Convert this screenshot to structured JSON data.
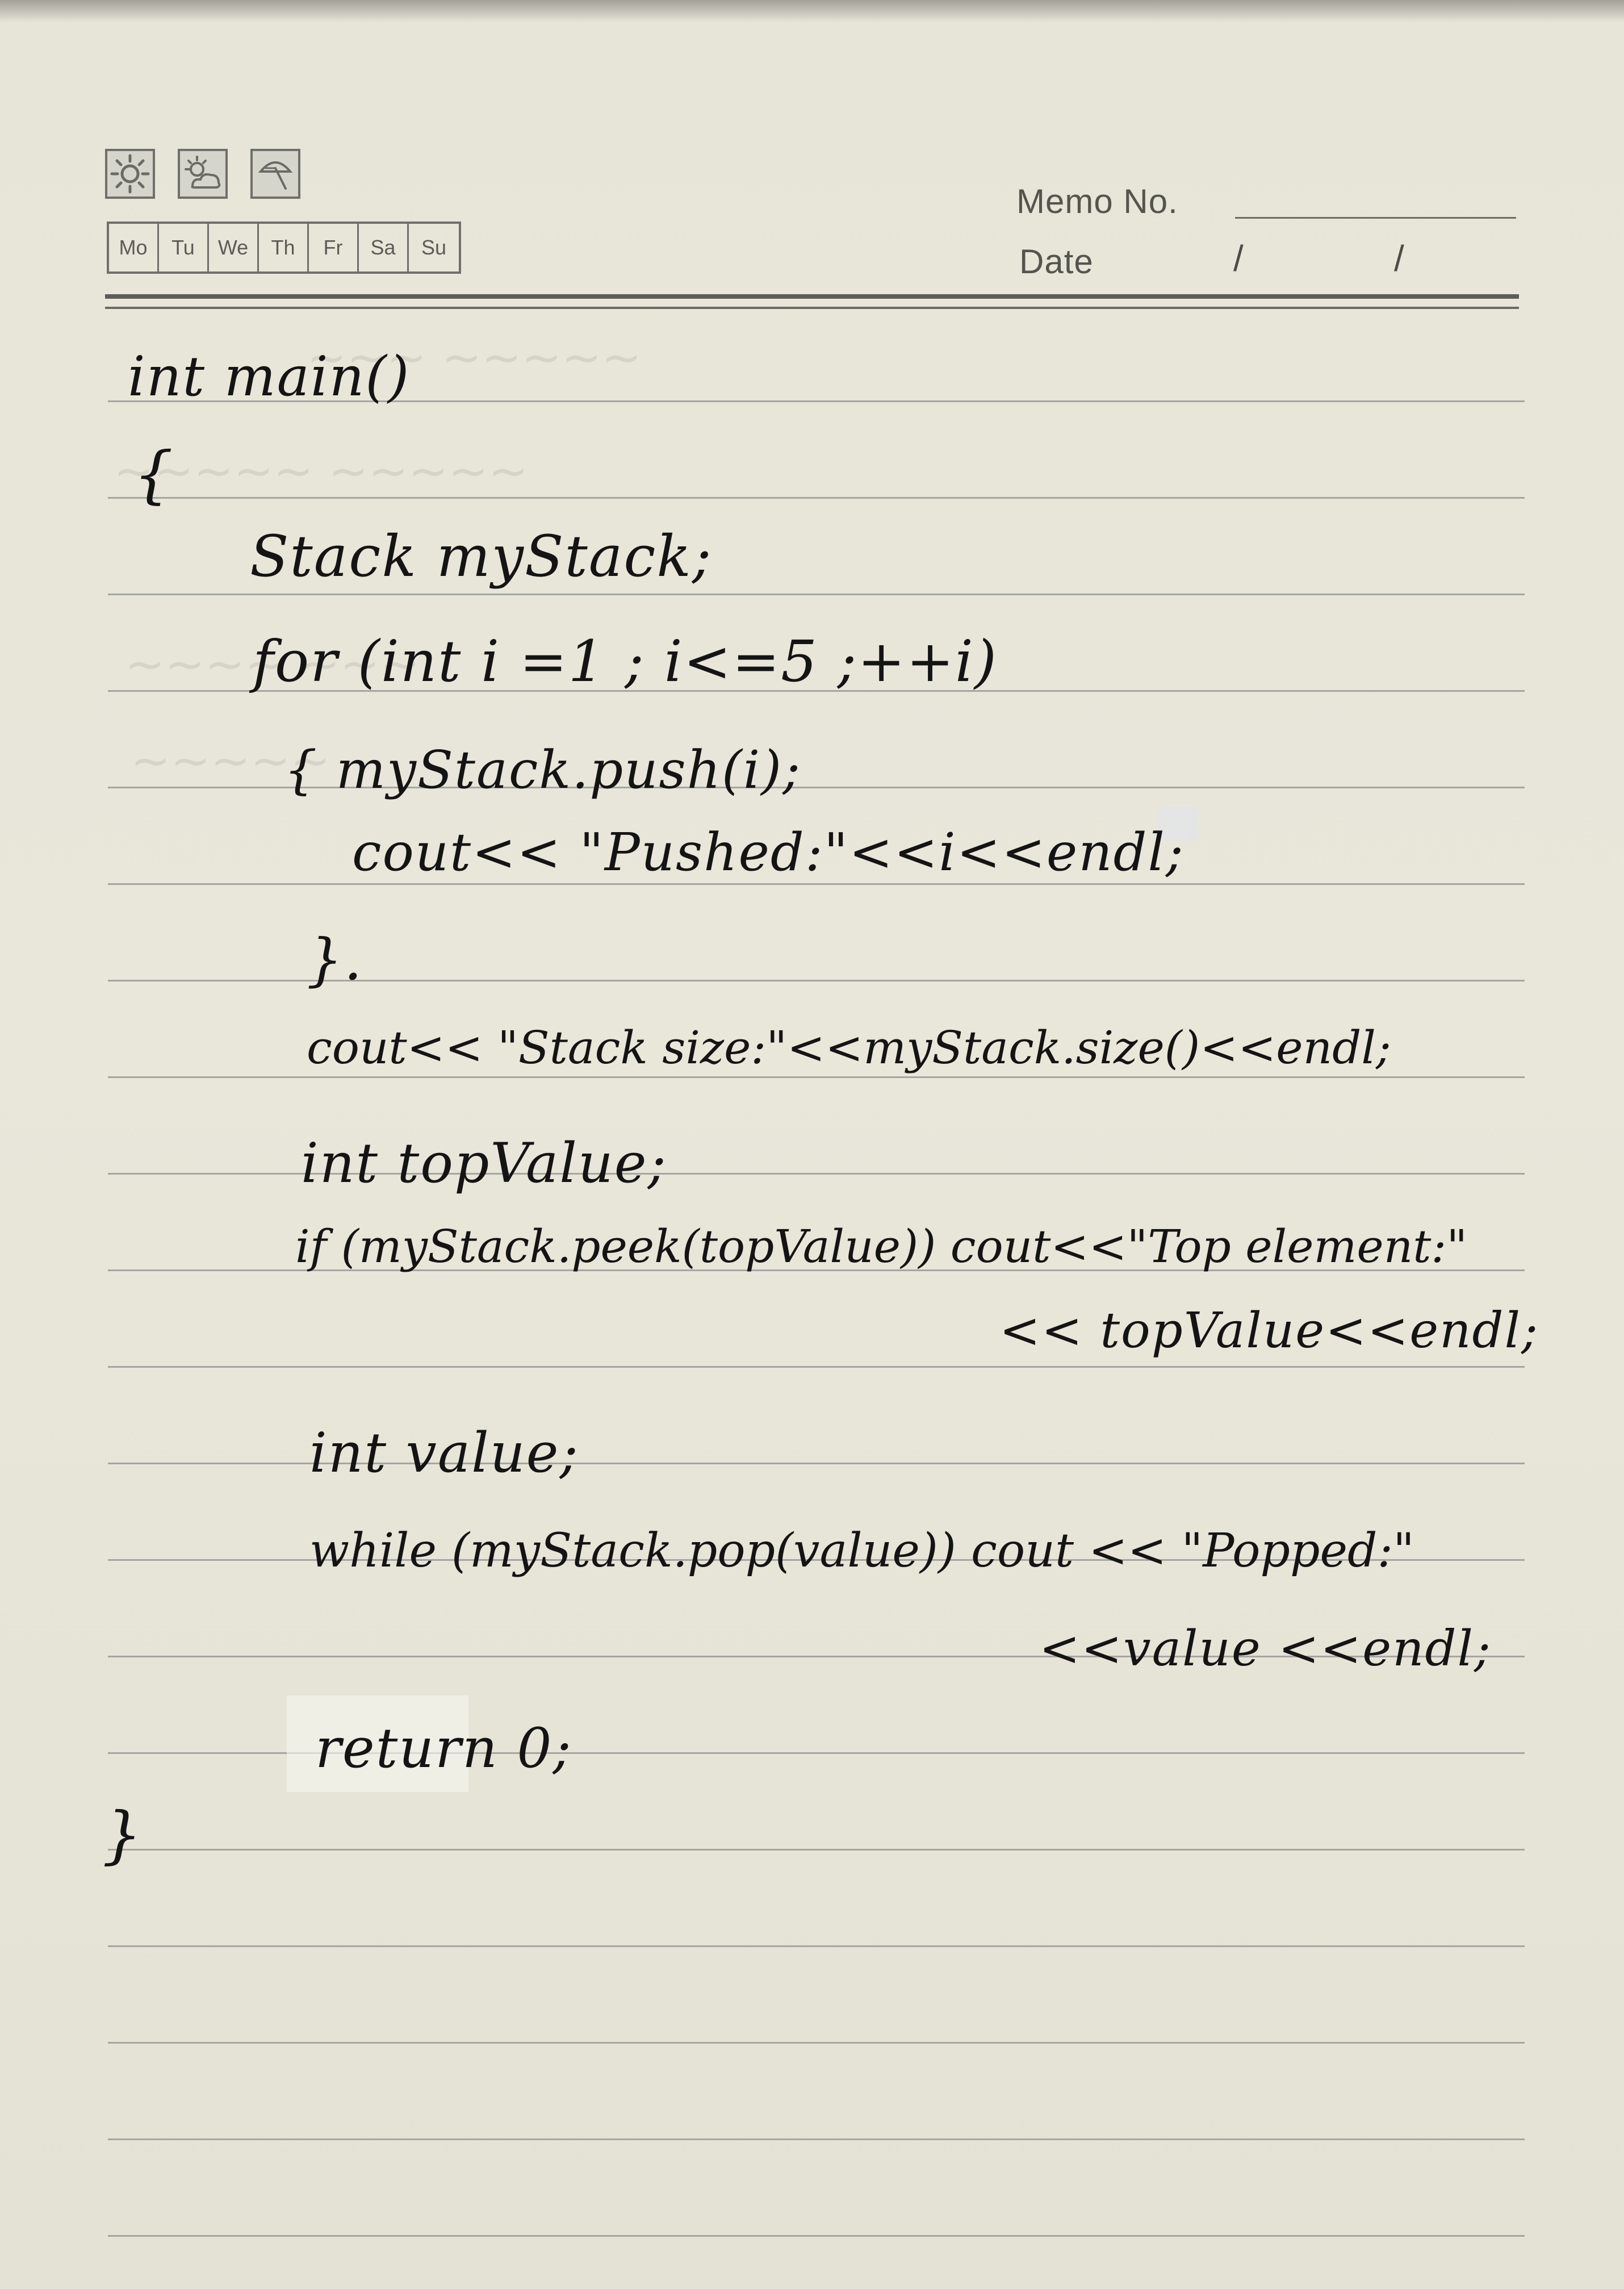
{
  "header": {
    "weather_icons": [
      "sun-icon",
      "partly-cloudy-icon",
      "umbrella-icon"
    ],
    "weekdays": [
      "Mo",
      "Tu",
      "We",
      "Th",
      "Fr",
      "Sa",
      "Su"
    ],
    "memo_label": "Memo No.",
    "date_label": "Date",
    "date_separator": "/"
  },
  "code": {
    "lines": [
      "int main()",
      "{",
      "Stack myStack;",
      "for (int i =1 ; i<=5 ;++i)",
      "{ myStack.push(i);",
      "cout<< \"Pushed:\"<<i<<endl;",
      "}.",
      "cout<< \"Stack size:\"<<myStack.size()<<endl;",
      "int topValue;",
      "if (myStack.peek(topValue)) cout<<\"Top element:\"",
      "<< topValue<<endl;",
      "int value;",
      "while (myStack.pop(value)) cout << \"Popped:\"",
      "<<value <<endl;",
      "return 0;",
      "}"
    ]
  }
}
